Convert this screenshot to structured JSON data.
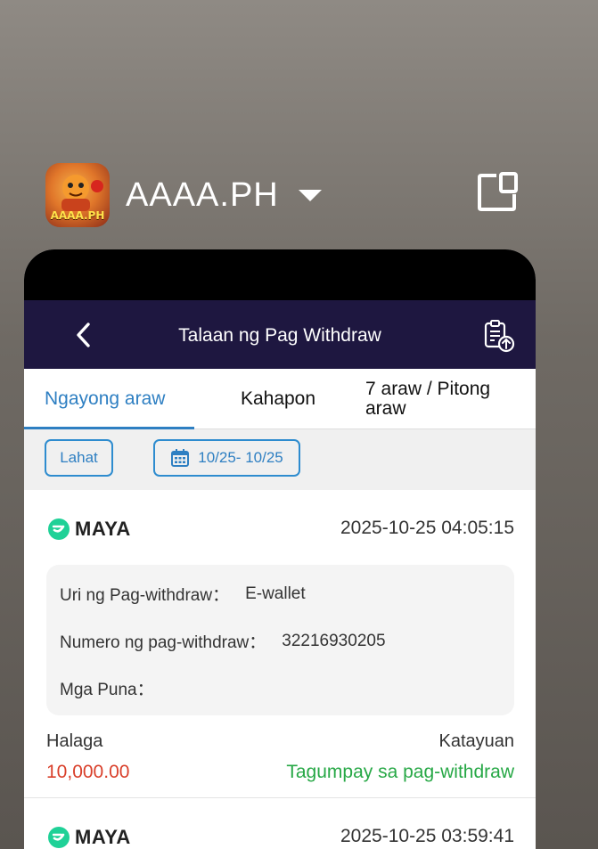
{
  "app": {
    "icon_label": "AAAA.PH",
    "name": "AAAA.PH",
    "caret_icon": "caret-down-icon",
    "window_icon": "window-toggle-icon"
  },
  "nav": {
    "title": "Talaan ng Pag Withdraw",
    "back_icon": "chevron-left-icon",
    "export_icon": "clipboard-upload-icon"
  },
  "tabs": [
    {
      "label": "Ngayong araw",
      "active": true
    },
    {
      "label": "Kahapon",
      "active": false
    },
    {
      "label": "7 araw / Pitong araw",
      "active": false
    }
  ],
  "filters": {
    "type_label": "Lahat",
    "date_range": "10/25- 10/25",
    "calendar_icon": "calendar-icon"
  },
  "records": [
    {
      "channel": "MAYA",
      "timestamp": "2025-10-25 04:05:15",
      "type_label": "Uri ng Pag-withdraw：",
      "type_value": "E-wallet",
      "number_label": "Numero ng pag-withdraw：",
      "number_value": "32216930205",
      "remarks_label": "Mga Puna：",
      "remarks_value": "",
      "amount_label": "Halaga",
      "amount": "10,000.00",
      "status_label": "Katayuan",
      "status": "Tagumpay sa pag-withdraw"
    },
    {
      "channel": "MAYA",
      "timestamp": "2025-10-25 03:59:41"
    }
  ],
  "colors": {
    "nav_bg": "#1e1740",
    "accent": "#2e7fc2",
    "amount": "#d9402b",
    "success": "#27a846",
    "maya": "#1fd197"
  }
}
